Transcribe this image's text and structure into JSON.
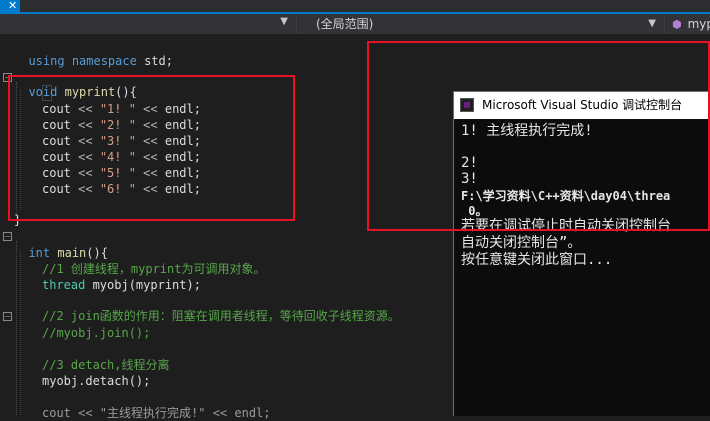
{
  "navbar": {
    "scope_label": "(全局范围)",
    "member_label": "myp"
  },
  "code": {
    "line1": "using namespace std;",
    "line2": "void myprint(){",
    "cout_lines": [
      "cout << \"1! \" << endl;",
      "cout << \"2! \" << endl;",
      "cout << \"3! \" << endl;",
      "cout << \"4! \" << endl;",
      "cout << \"5! \" << endl;",
      "cout << \"6! \" << endl;"
    ],
    "close_brace": "}",
    "main_sig": "int main(){",
    "comment1": "//1 创建线程，myprint为可调用对象。",
    "thread_line": "thread myobj(myprint);",
    "comment2": "//2 join函数的作用：阻塞在调用者线程，等待回收子线程资源。",
    "comment3": "//myobj.join();",
    "comment4": "//3 detach,线程分离",
    "detach_line": "myobj.detach();",
    "last_line_partial": "cout << \"主线程执行完成!\" << endl;"
  },
  "console": {
    "title": "Microsoft Visual Studio 调试控制台",
    "lines": [
      "1! 主线程执行完成!",
      "",
      "2!",
      "3!",
      "F:\\学习资料\\C++资料\\day04\\threa",
      " 0。",
      "若要在调试停止时自动关闭控制台",
      "自动关闭控制台”。",
      "按任意键关闭此窗口..."
    ]
  },
  "colors": {
    "highlight_box": "#e81123",
    "keyword": "#569cd6",
    "string": "#d69d85",
    "comment": "#57a64a"
  }
}
